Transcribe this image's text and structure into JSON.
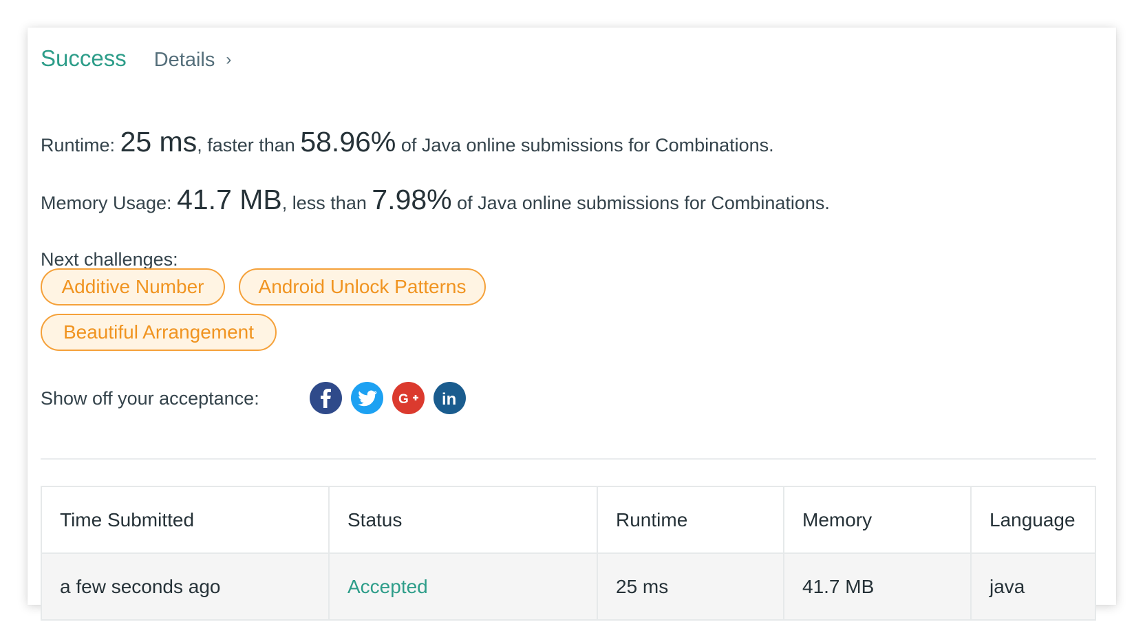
{
  "header": {
    "status": "Success",
    "details_label": "Details",
    "details_chevron": "›"
  },
  "runtime": {
    "label": "Runtime:",
    "value": "25 ms",
    "comparison": ", faster than",
    "percent": "58.96%",
    "suffix": "of Java online submissions for Combinations."
  },
  "memory": {
    "label": "Memory Usage:",
    "value": "41.7 MB",
    "comparison": ", less than",
    "percent": "7.98%",
    "suffix": "of Java online submissions for Combinations."
  },
  "next_challenges": {
    "label": "Next challenges:",
    "items": [
      "Additive Number",
      "Android Unlock Patterns",
      "Beautiful Arrangement"
    ]
  },
  "share": {
    "label": "Show off your acceptance:",
    "icons": [
      "facebook-icon",
      "twitter-icon",
      "google-plus-icon",
      "linkedin-icon"
    ]
  },
  "submissions": {
    "columns": [
      "Time Submitted",
      "Status",
      "Runtime",
      "Memory",
      "Language"
    ],
    "rows": [
      [
        "a few seconds ago",
        "Accepted",
        "25 ms",
        "41.7 MB",
        "java"
      ]
    ]
  },
  "colors": {
    "success": "#2d9d89",
    "tag_border": "#f5a13a",
    "tag_text": "#f09421",
    "facebook": "#2f4a8a",
    "twitter": "#1da1f2",
    "google_plus": "#db3a2e",
    "linkedin": "#1a5c8e"
  }
}
